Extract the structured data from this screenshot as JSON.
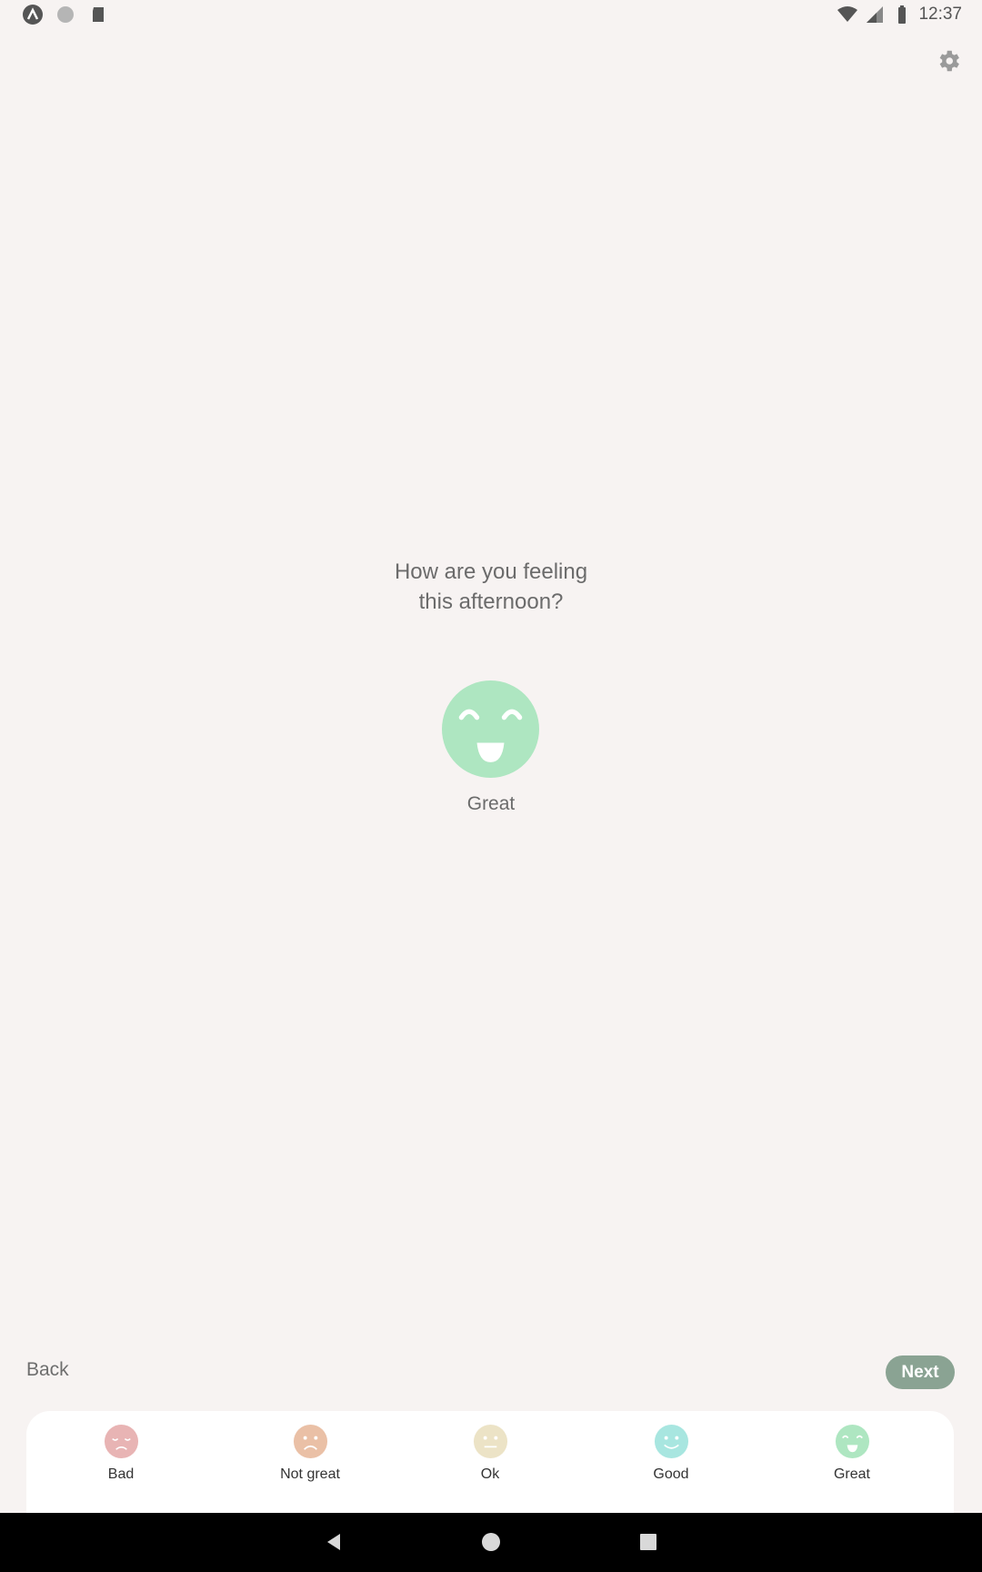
{
  "status_bar": {
    "time": "12:37",
    "left_icons": [
      "app-notification-icon",
      "circle-notification-icon",
      "sd-card-icon"
    ],
    "right_icons": [
      "wifi-icon",
      "signal-icon",
      "battery-icon"
    ]
  },
  "settings": {
    "icon": "gear-icon"
  },
  "prompt": {
    "question": "How are you feeling\nthis afternoon?"
  },
  "selected_mood": {
    "label": "Great",
    "color": "#aee6c1"
  },
  "nav": {
    "back_label": "Back",
    "next_label": "Next",
    "next_color": "#8aa393"
  },
  "moods": [
    {
      "label": "Bad",
      "color": "#e8b4b4"
    },
    {
      "label": "Not great",
      "color": "#eac0a6"
    },
    {
      "label": "Ok",
      "color": "#ece3c6"
    },
    {
      "label": "Good",
      "color": "#a8e6e0"
    },
    {
      "label": "Great",
      "color": "#aee6c1"
    }
  ],
  "system_nav": [
    "back-triangle-icon",
    "home-circle-icon",
    "recents-square-icon"
  ]
}
